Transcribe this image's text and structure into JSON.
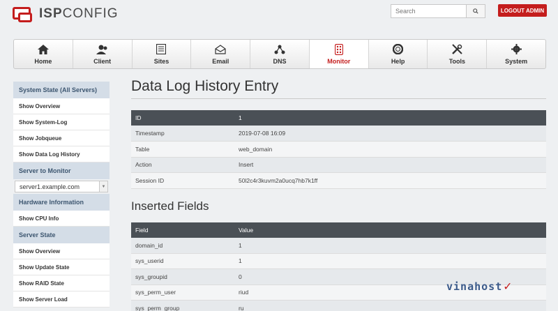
{
  "header": {
    "logo_bold": "ISP",
    "logo_rest": "CONFIG",
    "search_placeholder": "Search",
    "logout_label": "LOGOUT ADMIN"
  },
  "nav": [
    {
      "label": "Home",
      "icon": "home-icon"
    },
    {
      "label": "Client",
      "icon": "client-icon"
    },
    {
      "label": "Sites",
      "icon": "sites-icon"
    },
    {
      "label": "Email",
      "icon": "email-icon"
    },
    {
      "label": "DNS",
      "icon": "dns-icon"
    },
    {
      "label": "Monitor",
      "icon": "monitor-icon",
      "active": true
    },
    {
      "label": "Help",
      "icon": "help-icon"
    },
    {
      "label": "Tools",
      "icon": "tools-icon"
    },
    {
      "label": "System",
      "icon": "system-icon"
    }
  ],
  "sidebar": {
    "section1": "System State (All Servers)",
    "section1_links": [
      "Show Overview",
      "Show System-Log",
      "Show Jobqueue",
      "Show Data Log History"
    ],
    "section2": "Server to Monitor",
    "server_select": "server1.example.com",
    "section3": "Hardware Information",
    "section3_links": [
      "Show CPU Info"
    ],
    "section4": "Server State",
    "section4_links": [
      "Show Overview",
      "Show Update State",
      "Show RAID State",
      "Show Server Load"
    ]
  },
  "main": {
    "title": "Data Log History Entry",
    "entry_header": [
      "ID",
      "1"
    ],
    "entry_rows": [
      [
        "Timestamp",
        "2019-07-08 16:09"
      ],
      [
        "Table",
        "web_domain"
      ],
      [
        "Action",
        "Insert"
      ],
      [
        "Session ID",
        "50l2c4r3kuvm2a0ucq7hb7k1ff"
      ]
    ],
    "fields_title": "Inserted Fields",
    "fields_header": [
      "Field",
      "Value"
    ],
    "fields_rows": [
      [
        "domain_id",
        "1"
      ],
      [
        "sys_userid",
        "1"
      ],
      [
        "sys_groupid",
        "0"
      ],
      [
        "sys_perm_user",
        "riud"
      ],
      [
        "sys_perm_group",
        "ru"
      ]
    ]
  },
  "watermark": "vinahost",
  "colors": {
    "accent": "#c41d1d",
    "sidebar_head": "#d4dde7",
    "table_head": "#4a5056"
  }
}
